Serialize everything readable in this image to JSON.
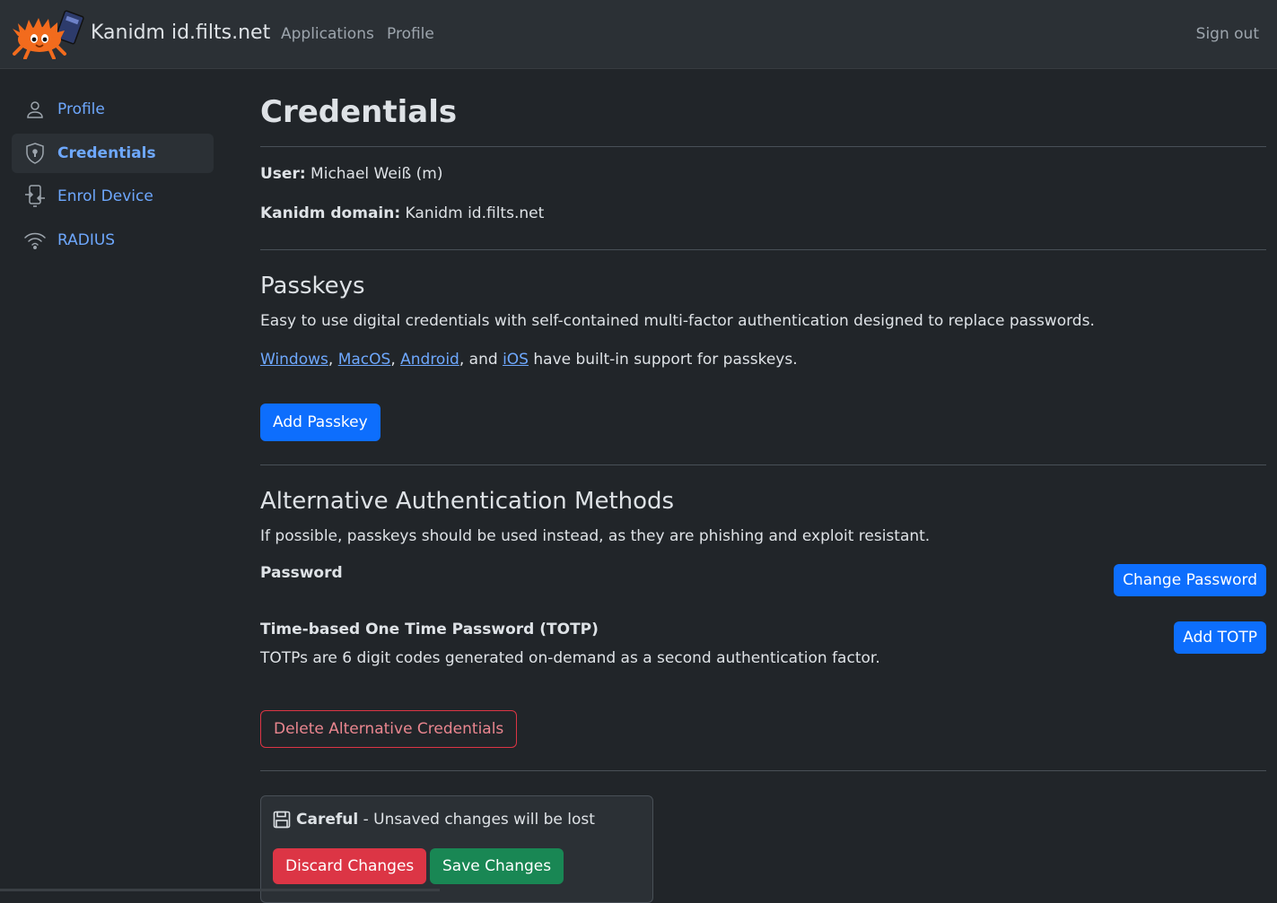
{
  "navbar": {
    "brand": "Kanidm id.filts.net",
    "links": [
      "Applications",
      "Profile"
    ],
    "sign_out": "Sign out"
  },
  "sidebar": {
    "items": [
      {
        "label": "Profile",
        "icon": "person-icon"
      },
      {
        "label": "Credentials",
        "icon": "shield-icon",
        "active": true
      },
      {
        "label": "Enrol Device",
        "icon": "device-icon"
      },
      {
        "label": "RADIUS",
        "icon": "wifi-icon"
      }
    ]
  },
  "main": {
    "title": "Credentials",
    "user_label": "User:",
    "user_value": "Michael Weiß (m)",
    "domain_label": "Kanidm domain:",
    "domain_value": "Kanidm id.filts.net",
    "passkeys": {
      "heading": "Passkeys",
      "description": "Easy to use digital credentials with self-contained multi-factor authentication designed to replace passwords.",
      "links": [
        "Windows",
        "MacOS",
        "Android",
        "iOS"
      ],
      "sep1": ",",
      "sep2": ",",
      "sep3": ", and",
      "support_suffix": "have built-in support for passkeys.",
      "add_button": "Add Passkey"
    },
    "alternative": {
      "heading": "Alternative Authentication Methods",
      "description": "If possible, passkeys should be used instead, as they are phishing and exploit resistant.",
      "password_label": "Password",
      "change_password_button": "Change Password",
      "totp_label": "Time-based One Time Password (TOTP)",
      "totp_description": "TOTPs are 6 digit codes generated on-demand as a second authentication factor.",
      "add_totp_button": "Add TOTP",
      "delete_button": "Delete Alternative Credentials"
    },
    "unsaved": {
      "careful": "Careful",
      "message": " - Unsaved changes will be lost",
      "discard_button": "Discard Changes",
      "save_button": "Save Changes"
    }
  },
  "colors": {
    "background": "#212529",
    "navbar": "#2b3035",
    "link": "#6ea8fe",
    "primary": "#0d6efd",
    "danger": "#dc3545",
    "success": "#198754"
  }
}
